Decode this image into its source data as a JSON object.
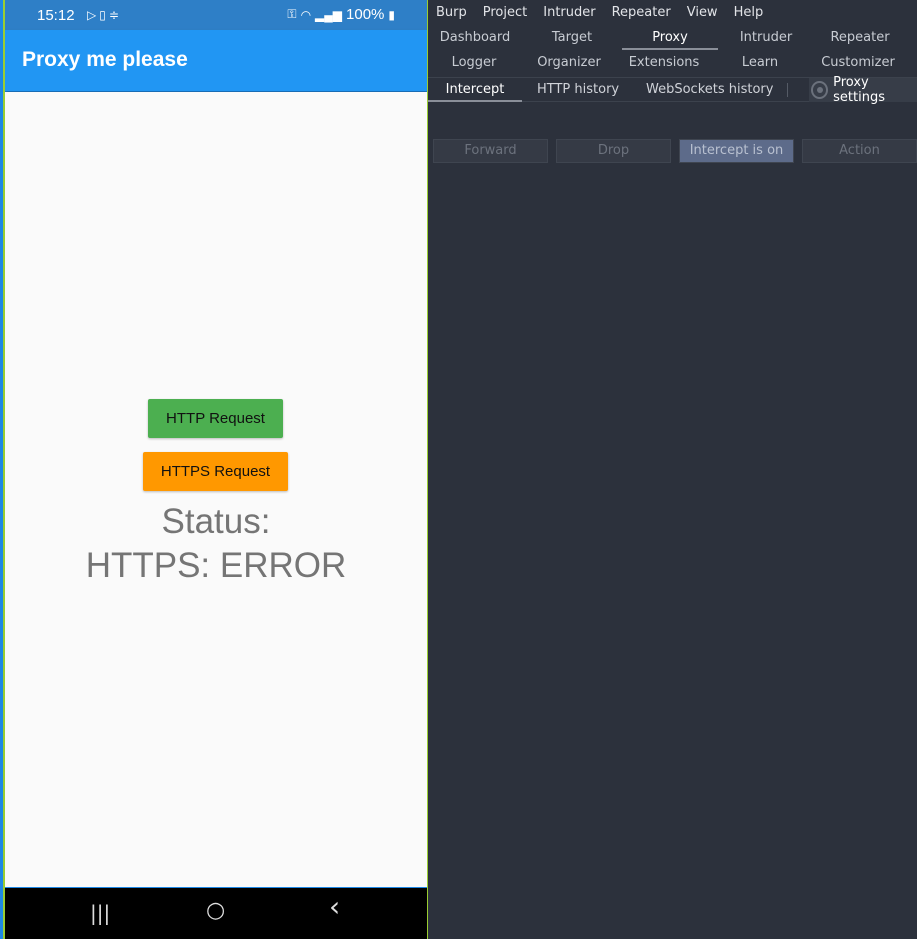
{
  "phone": {
    "status_bar": {
      "time": "15:12",
      "battery": "100%",
      "left_icons": [
        "play-store-icon",
        "sim-icon",
        "notification-icon"
      ],
      "right_icons": [
        "vpn-key-icon",
        "wifi-icon",
        "signal-icon",
        "battery-icon"
      ]
    },
    "app_title": "Proxy me please",
    "http_button": "HTTP Request",
    "https_button": "HTTPS Request",
    "status_label": "Status:",
    "status_value": "HTTPS: ERROR",
    "nav": {
      "recents": "|||",
      "home": "○",
      "back": "‹"
    },
    "colors": {
      "appbar": "#2196f3",
      "http_button": "#4caf50",
      "https_button": "#ff9800"
    }
  },
  "burp": {
    "menu": [
      "Burp",
      "Project",
      "Intruder",
      "Repeater",
      "View",
      "Help"
    ],
    "tabs_row1": [
      "Dashboard",
      "Target",
      "Proxy",
      "Intruder",
      "Repeater"
    ],
    "tabs_row2": [
      "Logger",
      "Organizer",
      "Extensions",
      "Learn",
      "Customizer"
    ],
    "selected_tab": "Proxy",
    "subtabs": [
      "Intercept",
      "HTTP history",
      "WebSockets history"
    ],
    "selected_subtab": "Intercept",
    "proxy_settings": "Proxy settings",
    "actions": {
      "forward": "Forward",
      "drop": "Drop",
      "intercept": "Intercept is on",
      "action": "Action"
    }
  }
}
